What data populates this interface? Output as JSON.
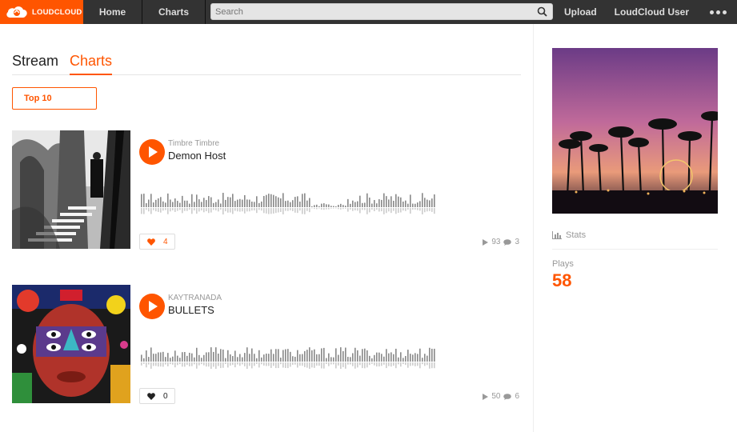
{
  "brand": {
    "name": "LOUDCLOUD",
    "color": "#ff5500"
  },
  "nav": {
    "home": "Home",
    "charts": "Charts",
    "search_placeholder": "Search",
    "upload": "Upload",
    "user": "LoudCloud User",
    "more_icon": "ellipsis-icon"
  },
  "main": {
    "tabs": [
      {
        "label": "Stream"
      },
      {
        "label": "Charts"
      }
    ],
    "filter_button": "Top 10",
    "tracks": [
      {
        "artist": "Timbre Timbre",
        "title": "Demon Host",
        "likes": "4",
        "liked": true,
        "plays": "93",
        "comments": "3"
      },
      {
        "artist": "KAYTRANADA",
        "title": "BULLETS",
        "likes": "0",
        "liked": false,
        "plays": "50",
        "comments": "6"
      }
    ]
  },
  "sidebar": {
    "stats_label": "Stats",
    "plays_label": "Plays",
    "plays_value": "58"
  }
}
